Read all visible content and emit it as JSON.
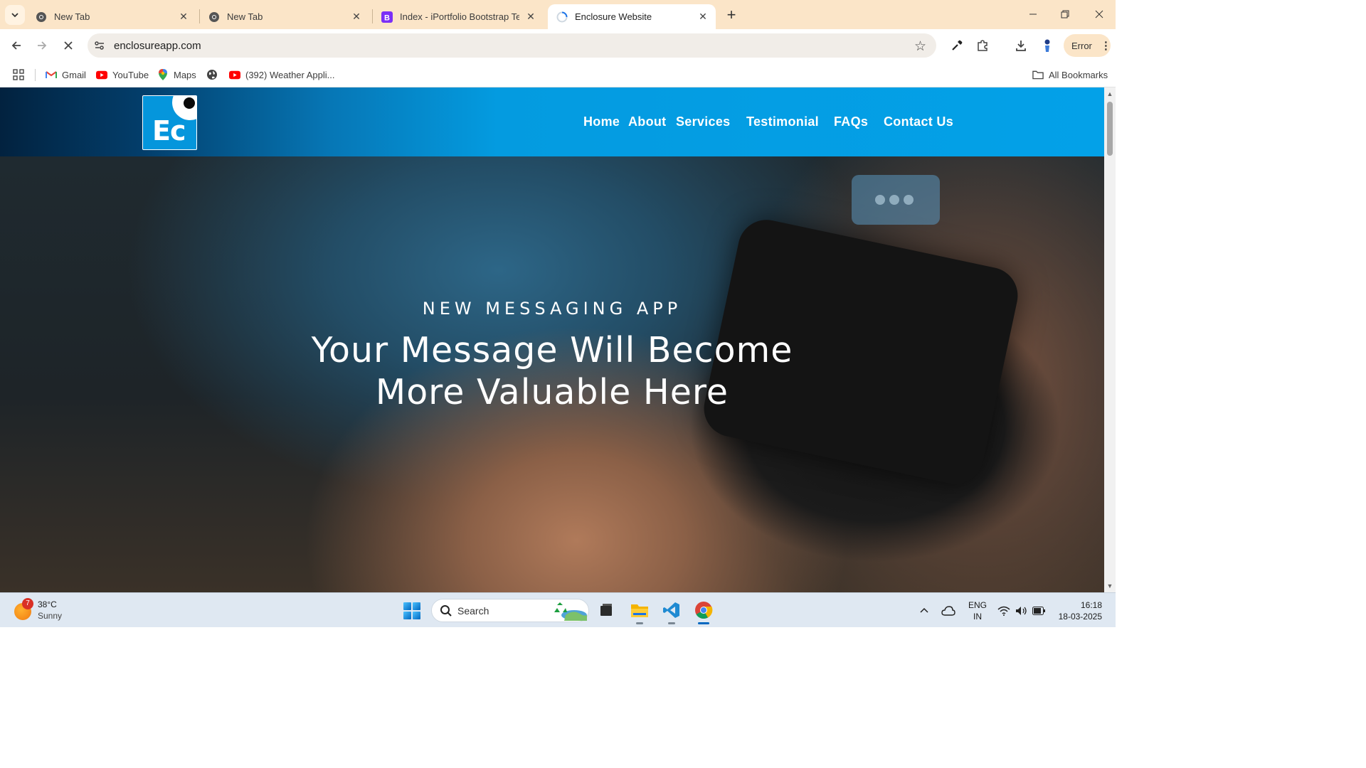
{
  "browser": {
    "tabs": [
      {
        "title": "New Tab",
        "favicon": "chrome-icon"
      },
      {
        "title": "New Tab",
        "favicon": "chrome-icon"
      },
      {
        "title": "Index - iPortfolio Bootstrap Template",
        "favicon": "bootstrap-icon"
      },
      {
        "title": "Enclosure Website",
        "favicon": "loading-icon",
        "active": true
      }
    ],
    "url": "enclosureapp.com",
    "profile_button": "Error",
    "bookmarks": [
      {
        "label": "Gmail",
        "icon": "gmail-icon"
      },
      {
        "label": "YouTube",
        "icon": "youtube-icon"
      },
      {
        "label": "Maps",
        "icon": "maps-icon"
      },
      {
        "label": "",
        "icon": "globe-icon"
      },
      {
        "label": "(392) Weather Appli...",
        "icon": "youtube-icon"
      }
    ],
    "all_bookmarks": "All Bookmarks"
  },
  "site": {
    "logo_text": "Ec",
    "nav": [
      "Home",
      "About",
      "Services",
      "Testimonial",
      "FAQs",
      "Contact Us"
    ],
    "hero": {
      "subtitle": "NEW MESSAGING APP",
      "headline_line1": "Your Message Will Become",
      "headline_line2": "More Valuable Here"
    },
    "colors": {
      "header_accent": "#03a1e8",
      "logo_bg": "#0596dc"
    }
  },
  "taskbar": {
    "weather_temp": "38°C",
    "weather_condition": "Sunny",
    "weather_badge": "7",
    "search_label": "Search",
    "lang_line1": "ENG",
    "lang_line2": "IN",
    "time": "16:18",
    "date": "18-03-2025"
  }
}
